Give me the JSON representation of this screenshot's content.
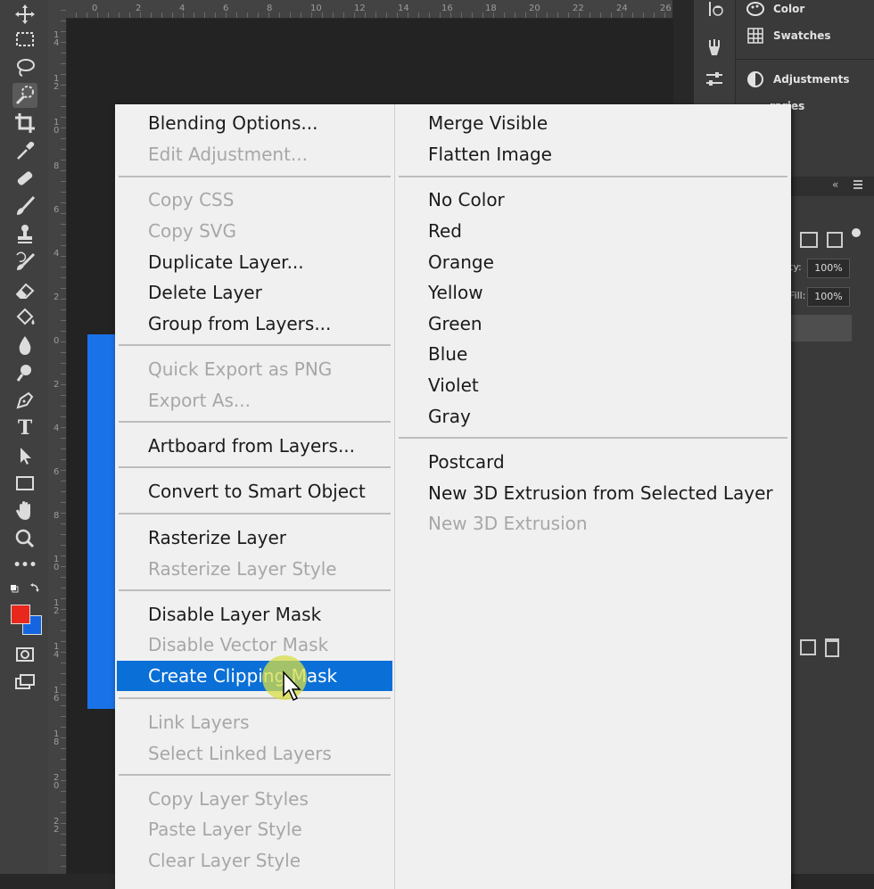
{
  "toolbar": {
    "tools": [
      "move-tool",
      "marquee-tool",
      "lasso-tool",
      "quick-selection-tool",
      "crop-tool",
      "eyedropper-tool",
      "healing-brush-tool",
      "brush-tool",
      "clone-stamp-tool",
      "history-brush-tool",
      "eraser-tool",
      "paint-bucket-tool",
      "blur-tool",
      "dodge-tool",
      "pen-tool",
      "type-tool",
      "path-selection-tool",
      "rectangle-tool",
      "hand-tool",
      "zoom-tool",
      "more-tools",
      "swap-colors"
    ],
    "type_tool_glyph": "T",
    "more_glyph": "•••",
    "foreground_color": "#e8281c",
    "background_color": "#1565e0"
  },
  "rulers": {
    "horizontal": [
      "0",
      "2",
      "4",
      "6",
      "8",
      "10",
      "12",
      "14",
      "16",
      "18",
      "20",
      "22",
      "24",
      "26"
    ],
    "vertical": [
      "1 4",
      "1 2",
      "1 0",
      "8",
      "6",
      "4",
      "2",
      "0",
      "2",
      "4",
      "6",
      "8",
      "1 0",
      "1 2",
      "1 4",
      "1 6",
      "1 8",
      "2 0",
      "2 2"
    ]
  },
  "panels": {
    "color": "Color",
    "swatches": "Swatches",
    "adjustments": "Adjustments",
    "libraries_partial": "raries",
    "layers_collapse": "«",
    "opacity_label": "ty:",
    "opacity_value": "100%",
    "fill_label": "Fill:",
    "fill_value": "100%"
  },
  "menu": {
    "left": [
      {
        "label": "Blending Options...",
        "enabled": true
      },
      {
        "label": "Edit Adjustment...",
        "enabled": false
      },
      {
        "label": "Copy CSS",
        "enabled": false
      },
      {
        "label": "Copy SVG",
        "enabled": false
      },
      {
        "label": "Duplicate Layer...",
        "enabled": true
      },
      {
        "label": "Delete Layer",
        "enabled": true
      },
      {
        "label": "Group from Layers...",
        "enabled": true
      },
      {
        "label": "Quick Export as PNG",
        "enabled": false
      },
      {
        "label": "Export As...",
        "enabled": false
      },
      {
        "label": "Artboard from Layers...",
        "enabled": true
      },
      {
        "label": "Convert to Smart Object",
        "enabled": true
      },
      {
        "label": "Rasterize Layer",
        "enabled": true
      },
      {
        "label": "Rasterize Layer Style",
        "enabled": false
      },
      {
        "label": "Disable Layer Mask",
        "enabled": true
      },
      {
        "label": "Disable Vector Mask",
        "enabled": false
      },
      {
        "label": "Create Clipping Mask",
        "enabled": true,
        "highlighted": true
      },
      {
        "label": "Link Layers",
        "enabled": false
      },
      {
        "label": "Select Linked Layers",
        "enabled": false
      },
      {
        "label": "Copy Layer Styles",
        "enabled": false
      },
      {
        "label": "Paste Layer Style",
        "enabled": false
      },
      {
        "label": "Clear Layer Style",
        "enabled": false
      }
    ],
    "right": [
      {
        "label": "Merge Visible",
        "enabled": true
      },
      {
        "label": "Flatten Image",
        "enabled": true
      },
      {
        "label": "No Color",
        "enabled": true
      },
      {
        "label": "Red",
        "enabled": true
      },
      {
        "label": "Orange",
        "enabled": true
      },
      {
        "label": "Yellow",
        "enabled": true
      },
      {
        "label": "Green",
        "enabled": true
      },
      {
        "label": "Blue",
        "enabled": true
      },
      {
        "label": "Violet",
        "enabled": true
      },
      {
        "label": "Gray",
        "enabled": true
      },
      {
        "label": "Postcard",
        "enabled": true
      },
      {
        "label": "New 3D Extrusion from Selected Layer",
        "enabled": true
      },
      {
        "label": "New 3D Extrusion",
        "enabled": false
      }
    ],
    "highlight_color": "#0a6fd6"
  }
}
